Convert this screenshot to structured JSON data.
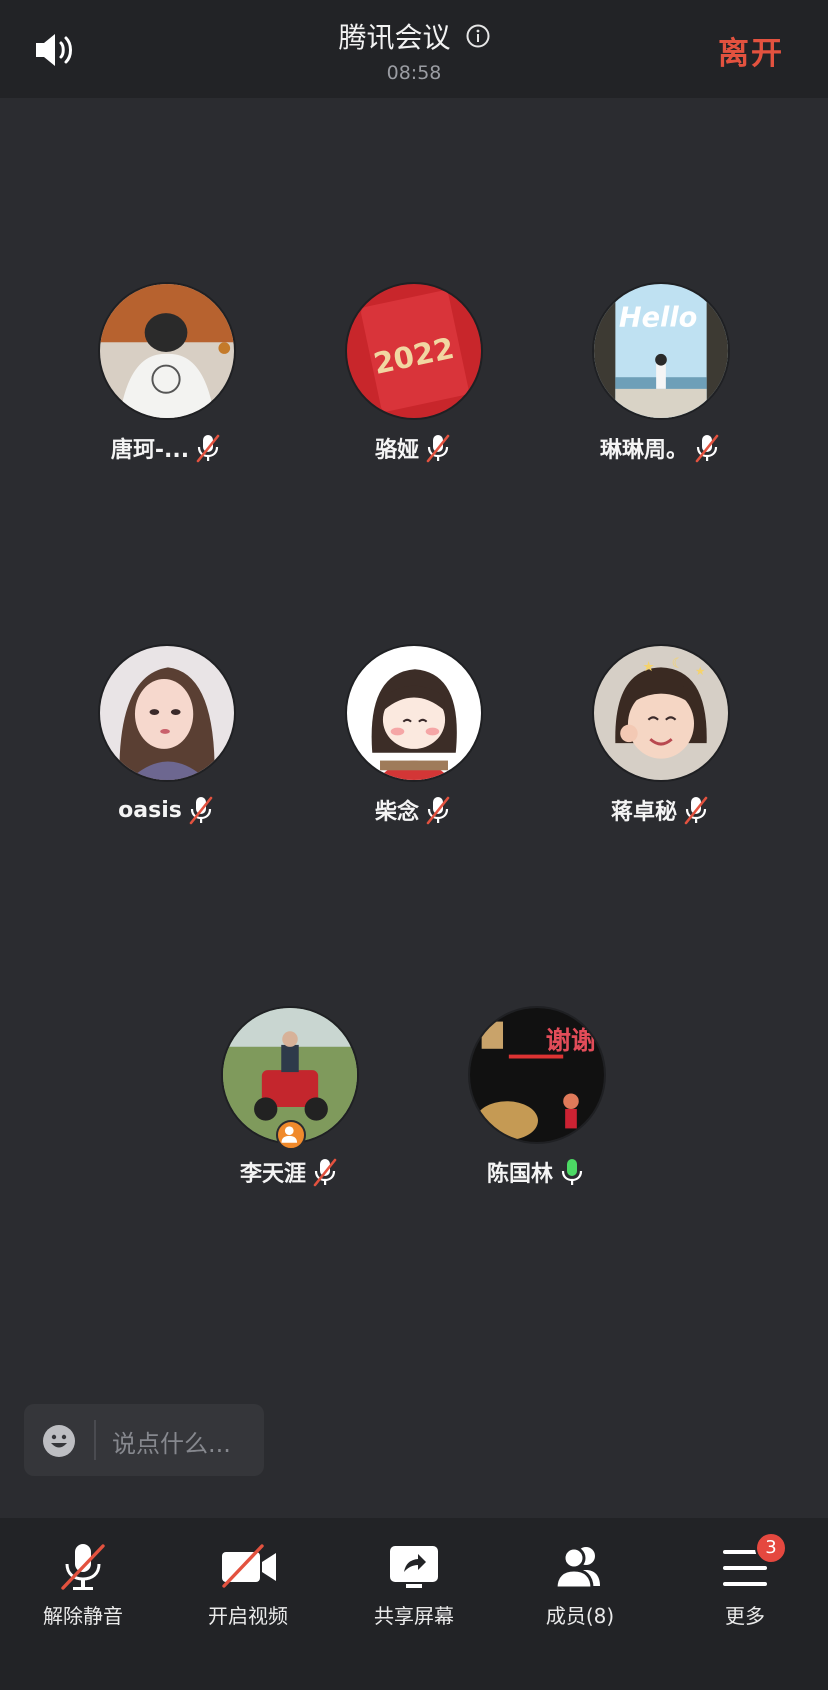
{
  "header": {
    "title": "腾讯会议",
    "time": "08:58",
    "leave_label": "离开"
  },
  "participants": [
    {
      "name": "唐珂-...",
      "mic": "muted"
    },
    {
      "name": "骆娅",
      "mic": "muted",
      "avatar_text": "2022"
    },
    {
      "name": "琳琳周。",
      "mic": "muted",
      "avatar_text": "Hello"
    },
    {
      "name": "oasis",
      "mic": "muted"
    },
    {
      "name": "柴念",
      "mic": "muted"
    },
    {
      "name": "蒋卓秘",
      "mic": "muted"
    },
    {
      "name": "李天涯",
      "mic": "muted",
      "host": true
    },
    {
      "name": "陈国林",
      "mic": "on",
      "avatar_text": "谢谢"
    }
  ],
  "chat": {
    "placeholder": "说点什么..."
  },
  "toolbar": {
    "items": [
      {
        "label": "解除静音",
        "icon": "mic-muted-icon"
      },
      {
        "label": "开启视频",
        "icon": "video-off-icon"
      },
      {
        "label": "共享屏幕",
        "icon": "share-screen-icon"
      },
      {
        "label": "成员(8)",
        "icon": "members-icon"
      },
      {
        "label": "更多",
        "icon": "more-menu-icon",
        "badge": "3"
      }
    ]
  },
  "colors": {
    "accent_red": "#e3523f",
    "mic_on_green": "#4cd964",
    "background": "#2b2c30",
    "bar": "#222326"
  }
}
